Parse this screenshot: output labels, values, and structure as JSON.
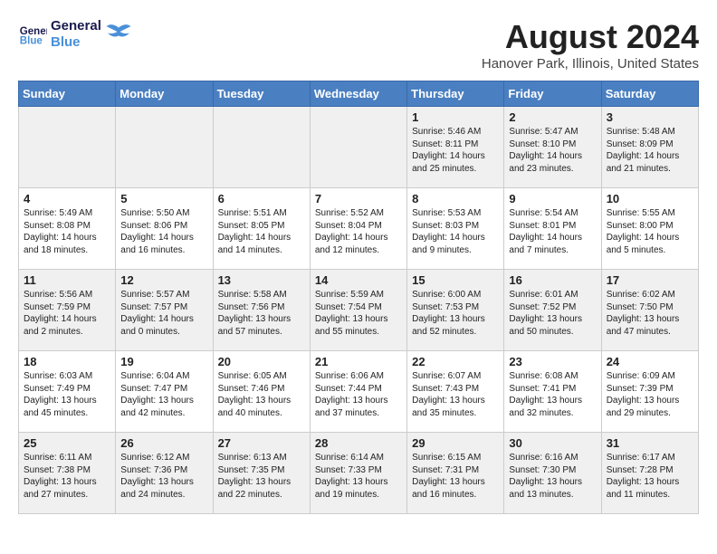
{
  "header": {
    "logo_general": "General",
    "logo_blue": "Blue",
    "month": "August 2024",
    "location": "Hanover Park, Illinois, United States"
  },
  "days_of_week": [
    "Sunday",
    "Monday",
    "Tuesday",
    "Wednesday",
    "Thursday",
    "Friday",
    "Saturday"
  ],
  "weeks": [
    [
      {
        "day": "",
        "info": ""
      },
      {
        "day": "",
        "info": ""
      },
      {
        "day": "",
        "info": ""
      },
      {
        "day": "",
        "info": ""
      },
      {
        "day": "1",
        "info": "Sunrise: 5:46 AM\nSunset: 8:11 PM\nDaylight: 14 hours and 25 minutes."
      },
      {
        "day": "2",
        "info": "Sunrise: 5:47 AM\nSunset: 8:10 PM\nDaylight: 14 hours and 23 minutes."
      },
      {
        "day": "3",
        "info": "Sunrise: 5:48 AM\nSunset: 8:09 PM\nDaylight: 14 hours and 21 minutes."
      }
    ],
    [
      {
        "day": "4",
        "info": "Sunrise: 5:49 AM\nSunset: 8:08 PM\nDaylight: 14 hours and 18 minutes."
      },
      {
        "day": "5",
        "info": "Sunrise: 5:50 AM\nSunset: 8:06 PM\nDaylight: 14 hours and 16 minutes."
      },
      {
        "day": "6",
        "info": "Sunrise: 5:51 AM\nSunset: 8:05 PM\nDaylight: 14 hours and 14 minutes."
      },
      {
        "day": "7",
        "info": "Sunrise: 5:52 AM\nSunset: 8:04 PM\nDaylight: 14 hours and 12 minutes."
      },
      {
        "day": "8",
        "info": "Sunrise: 5:53 AM\nSunset: 8:03 PM\nDaylight: 14 hours and 9 minutes."
      },
      {
        "day": "9",
        "info": "Sunrise: 5:54 AM\nSunset: 8:01 PM\nDaylight: 14 hours and 7 minutes."
      },
      {
        "day": "10",
        "info": "Sunrise: 5:55 AM\nSunset: 8:00 PM\nDaylight: 14 hours and 5 minutes."
      }
    ],
    [
      {
        "day": "11",
        "info": "Sunrise: 5:56 AM\nSunset: 7:59 PM\nDaylight: 14 hours and 2 minutes."
      },
      {
        "day": "12",
        "info": "Sunrise: 5:57 AM\nSunset: 7:57 PM\nDaylight: 14 hours and 0 minutes."
      },
      {
        "day": "13",
        "info": "Sunrise: 5:58 AM\nSunset: 7:56 PM\nDaylight: 13 hours and 57 minutes."
      },
      {
        "day": "14",
        "info": "Sunrise: 5:59 AM\nSunset: 7:54 PM\nDaylight: 13 hours and 55 minutes."
      },
      {
        "day": "15",
        "info": "Sunrise: 6:00 AM\nSunset: 7:53 PM\nDaylight: 13 hours and 52 minutes."
      },
      {
        "day": "16",
        "info": "Sunrise: 6:01 AM\nSunset: 7:52 PM\nDaylight: 13 hours and 50 minutes."
      },
      {
        "day": "17",
        "info": "Sunrise: 6:02 AM\nSunset: 7:50 PM\nDaylight: 13 hours and 47 minutes."
      }
    ],
    [
      {
        "day": "18",
        "info": "Sunrise: 6:03 AM\nSunset: 7:49 PM\nDaylight: 13 hours and 45 minutes."
      },
      {
        "day": "19",
        "info": "Sunrise: 6:04 AM\nSunset: 7:47 PM\nDaylight: 13 hours and 42 minutes."
      },
      {
        "day": "20",
        "info": "Sunrise: 6:05 AM\nSunset: 7:46 PM\nDaylight: 13 hours and 40 minutes."
      },
      {
        "day": "21",
        "info": "Sunrise: 6:06 AM\nSunset: 7:44 PM\nDaylight: 13 hours and 37 minutes."
      },
      {
        "day": "22",
        "info": "Sunrise: 6:07 AM\nSunset: 7:43 PM\nDaylight: 13 hours and 35 minutes."
      },
      {
        "day": "23",
        "info": "Sunrise: 6:08 AM\nSunset: 7:41 PM\nDaylight: 13 hours and 32 minutes."
      },
      {
        "day": "24",
        "info": "Sunrise: 6:09 AM\nSunset: 7:39 PM\nDaylight: 13 hours and 29 minutes."
      }
    ],
    [
      {
        "day": "25",
        "info": "Sunrise: 6:11 AM\nSunset: 7:38 PM\nDaylight: 13 hours and 27 minutes."
      },
      {
        "day": "26",
        "info": "Sunrise: 6:12 AM\nSunset: 7:36 PM\nDaylight: 13 hours and 24 minutes."
      },
      {
        "day": "27",
        "info": "Sunrise: 6:13 AM\nSunset: 7:35 PM\nDaylight: 13 hours and 22 minutes."
      },
      {
        "day": "28",
        "info": "Sunrise: 6:14 AM\nSunset: 7:33 PM\nDaylight: 13 hours and 19 minutes."
      },
      {
        "day": "29",
        "info": "Sunrise: 6:15 AM\nSunset: 7:31 PM\nDaylight: 13 hours and 16 minutes."
      },
      {
        "day": "30",
        "info": "Sunrise: 6:16 AM\nSunset: 7:30 PM\nDaylight: 13 hours and 13 minutes."
      },
      {
        "day": "31",
        "info": "Sunrise: 6:17 AM\nSunset: 7:28 PM\nDaylight: 13 hours and 11 minutes."
      }
    ]
  ]
}
